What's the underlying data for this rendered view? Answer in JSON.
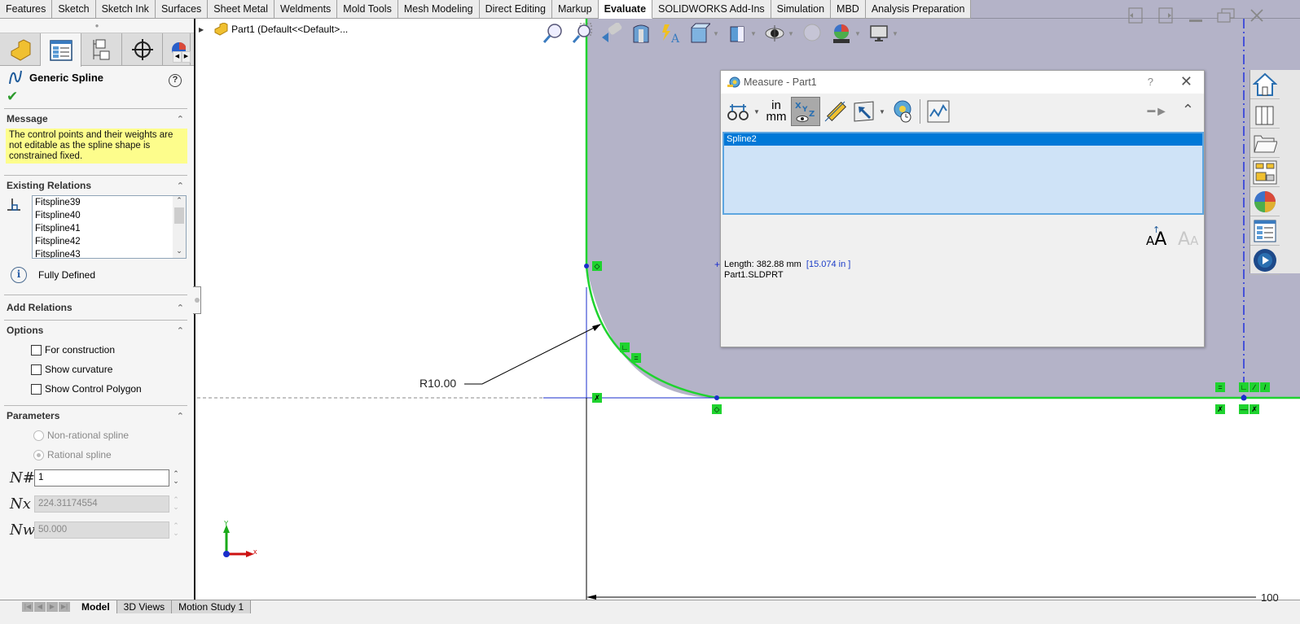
{
  "command_tabs": [
    {
      "label": "Features",
      "active": false
    },
    {
      "label": "Sketch",
      "active": false
    },
    {
      "label": "Sketch Ink",
      "active": false
    },
    {
      "label": "Surfaces",
      "active": false
    },
    {
      "label": "Sheet Metal",
      "active": false
    },
    {
      "label": "Weldments",
      "active": false
    },
    {
      "label": "Mold Tools",
      "active": false
    },
    {
      "label": "Mesh Modeling",
      "active": false
    },
    {
      "label": "Direct Editing",
      "active": false
    },
    {
      "label": "Markup",
      "active": false
    },
    {
      "label": "Evaluate",
      "active": true
    },
    {
      "label": "SOLIDWORKS Add-Ins",
      "active": false
    },
    {
      "label": "Simulation",
      "active": false
    },
    {
      "label": "MBD",
      "active": false
    },
    {
      "label": "Analysis Preparation",
      "active": false
    }
  ],
  "window_controls": {
    "tile_left": "tile-left-icon",
    "tile_right": "tile-right-icon",
    "minimize": "minimize-icon",
    "restore": "restore-icon",
    "close": "close-icon"
  },
  "feature_tree": {
    "root_label": "Part1  (Default<<Default>...",
    "panel_tabs": [
      "feature-manager",
      "property-manager",
      "configuration-manager",
      "dimxpert-manager",
      "display-manager"
    ]
  },
  "property_manager": {
    "title": "Generic Spline",
    "help": "?",
    "ok": "✔",
    "sections": {
      "message": {
        "title": "Message",
        "text": "The control points and their weights are not editable as the spline shape is constrained fixed."
      },
      "existing_relations": {
        "title": "Existing Relations",
        "items": [
          "Fitspline39",
          "Fitspline40",
          "Fitspline41",
          "Fitspline42",
          "Fitspline43"
        ],
        "status": "Fully Defined"
      },
      "add_relations": {
        "title": "Add Relations"
      },
      "options": {
        "title": "Options",
        "checkboxes": [
          {
            "label": "For construction",
            "checked": false
          },
          {
            "label": "Show curvature",
            "checked": false
          },
          {
            "label": "Show Control Polygon",
            "checked": false
          }
        ]
      },
      "parameters": {
        "title": "Parameters",
        "radios": [
          {
            "label": "Non-rational spline",
            "selected": false
          },
          {
            "label": "Rational spline",
            "selected": true
          }
        ],
        "fields": [
          {
            "icon": "N#",
            "value": "1",
            "disabled": false
          },
          {
            "icon": "Nx",
            "value": "224.31174554",
            "disabled": true
          },
          {
            "icon": "Nw",
            "value": "50.000",
            "disabled": true
          }
        ]
      }
    }
  },
  "bottom_tabs": [
    {
      "label": "Model",
      "active": true
    },
    {
      "label": "3D Views",
      "active": false
    },
    {
      "label": "Motion Study 1",
      "active": false
    }
  ],
  "measure_dialog": {
    "title": "Measure - Part1",
    "help": "?",
    "close": "✕",
    "units_top": "in",
    "units_bottom": "mm",
    "selection": "Spline2",
    "result_length": "Length: 382.88 mm",
    "result_alt": "[15.074 in ]",
    "result_file": "Part1.SLDPRT"
  },
  "sketch": {
    "radius_dim": "R10.00",
    "bottom_dim": "100",
    "axis_x": "x",
    "axis_y": "Y"
  },
  "colors": {
    "viewport_bg": "#b4b3c8",
    "sketch_green": "#1fd32f",
    "selection_blue": "#0078d7",
    "message_yellow": "#fdfd8c"
  }
}
